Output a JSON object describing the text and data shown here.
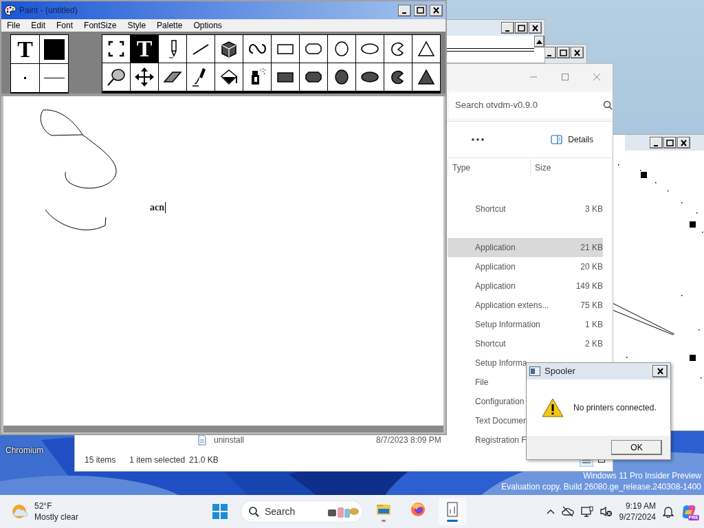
{
  "paint": {
    "title": "Paint - (untitled)",
    "menu": [
      "File",
      "Edit",
      "Font",
      "FontSize",
      "Style",
      "Palette",
      "Options"
    ],
    "font_preview": "T",
    "canvas_text": "acn",
    "tools": [
      {
        "kind": "select",
        "selected": false
      },
      {
        "kind": "text",
        "label": "T",
        "selected": true
      },
      {
        "kind": "pencil",
        "selected": false
      },
      {
        "kind": "line",
        "selected": false
      },
      {
        "kind": "box3d",
        "selected": false
      },
      {
        "kind": "curve",
        "selected": false
      },
      {
        "kind": "rect",
        "selected": false
      },
      {
        "kind": "roundrect",
        "selected": false
      },
      {
        "kind": "circle",
        "selected": false
      },
      {
        "kind": "ellipse",
        "selected": false
      },
      {
        "kind": "pie",
        "selected": false
      },
      {
        "kind": "triangle",
        "selected": false
      },
      {
        "kind": "lasso",
        "selected": false
      },
      {
        "kind": "move",
        "selected": false
      },
      {
        "kind": "eraser",
        "selected": false
      },
      {
        "kind": "brush",
        "selected": false
      },
      {
        "kind": "fill",
        "selected": false
      },
      {
        "kind": "spray",
        "selected": false
      },
      {
        "kind": "rect_filled",
        "selected": false
      },
      {
        "kind": "roundrect_filled",
        "selected": false
      },
      {
        "kind": "circle_filled",
        "selected": false
      },
      {
        "kind": "ellipse_filled",
        "selected": false
      },
      {
        "kind": "pie_filled",
        "selected": false
      },
      {
        "kind": "triangle_filled",
        "selected": false
      }
    ]
  },
  "explorer": {
    "search_placeholder": "Search otvdm-v0.9.0",
    "details_button": "Details",
    "columns": [
      "Type",
      "Size"
    ],
    "rows": [
      {
        "kind": "blank",
        "selected": false
      },
      {
        "kind": "file",
        "type": "Shortcut",
        "size": "3 KB",
        "selected": false
      },
      {
        "kind": "blank",
        "selected": false
      },
      {
        "kind": "file",
        "type": "Application",
        "size": "21 KB",
        "selected": true
      },
      {
        "kind": "file",
        "type": "Application",
        "size": "20 KB",
        "selected": false
      },
      {
        "kind": "file",
        "type": "Application",
        "size": "149 KB",
        "selected": false
      },
      {
        "kind": "file",
        "type": "Application extens...",
        "size": "75 KB",
        "selected": false
      },
      {
        "kind": "file",
        "type": "Setup Information",
        "size": "1 KB",
        "selected": false
      },
      {
        "kind": "file",
        "type": "Shortcut",
        "size": "2 KB",
        "selected": false
      },
      {
        "kind": "file",
        "type": "Setup Informa",
        "selected": false
      },
      {
        "kind": "file",
        "type": "File",
        "selected": false
      },
      {
        "kind": "file",
        "type": "Configuration",
        "selected": false
      },
      {
        "kind": "file",
        "type": "Text Documen",
        "selected": false
      },
      {
        "kind": "file",
        "name": "uninstall",
        "date": "8/7/2023 8:09 PM",
        "type": "Registration F",
        "selected": false
      }
    ],
    "status": [
      "15 items",
      "1 item selected",
      "21.0 KB"
    ]
  },
  "spooler": {
    "title": "Spooler",
    "message": "No printers connected.",
    "button": "OK"
  },
  "desktop": {
    "icons": [
      {
        "label": "Chromium"
      }
    ],
    "watermark": [
      "Windows 11 Pro Insider Preview",
      "Evaluation copy. Build 26080.ge_release.240308-1400"
    ]
  },
  "taskbar": {
    "weather": {
      "temperature": "52°F",
      "condition": "Mostly clear"
    },
    "search_placeholder": "Search",
    "apps": [
      {
        "kind": "explorer",
        "open": true,
        "active": false
      },
      {
        "kind": "firefox",
        "open": false,
        "active": false
      },
      {
        "kind": "app",
        "open": true,
        "active": true
      }
    ],
    "time": "9:19 AM",
    "date": "9/27/2024",
    "copilot_badge": "PRE"
  }
}
